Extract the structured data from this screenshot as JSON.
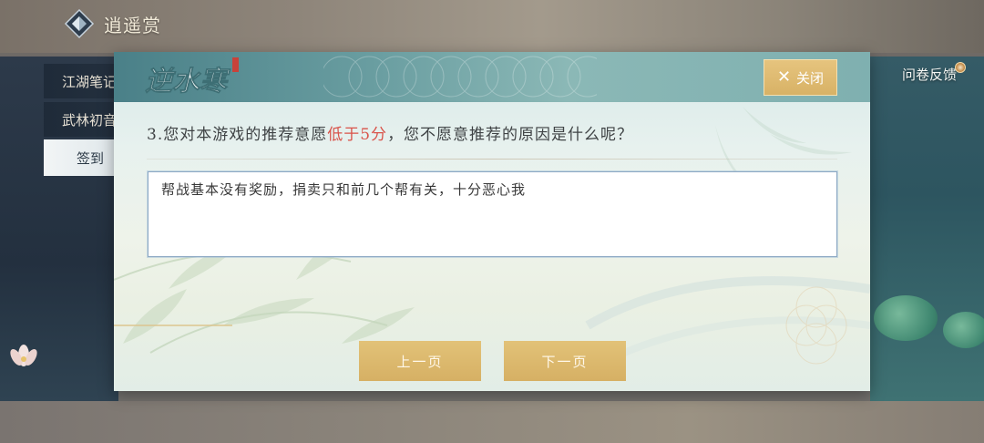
{
  "app": {
    "title": "逍遥赏",
    "logo_icon": "diamond-logo-icon"
  },
  "sidebar": {
    "items": [
      {
        "label": "江湖笔记",
        "active": false
      },
      {
        "label": "武林初音",
        "active": false
      },
      {
        "label": "签到",
        "active": true
      }
    ]
  },
  "header_right": {
    "survey_label": "问卷反馈"
  },
  "dialog": {
    "brand_text": "逆水寒",
    "brand_icon": "game-brand-logo-icon",
    "close_label": "关闭",
    "close_icon": "close-x-icon",
    "question_prefix": "3.您对本游戏的推荐意愿",
    "question_highlight": "低于5分",
    "question_suffix": "，您不愿意推荐的原因是什么呢？",
    "answer_value": "帮战基本没有奖励，捐卖只和前几个帮有关，十分恶心我",
    "prev_label": "上一页",
    "next_label": "下一页"
  },
  "colors": {
    "accent_gold": "#d8b266",
    "highlight_red": "#d9534a",
    "header_teal": "#6a9ea1"
  }
}
